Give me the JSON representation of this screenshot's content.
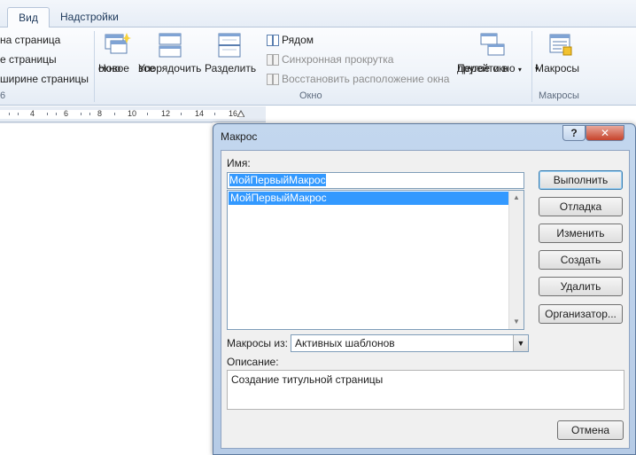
{
  "tabs": {
    "view": "Вид",
    "addins": "Надстройки"
  },
  "ribbon": {
    "page_view_items": [
      "на страница",
      "е страницы",
      "ширине страницы"
    ],
    "zoom_group_label_fragment": "6",
    "window_group": {
      "new_window": [
        "Новое",
        "окно"
      ],
      "arrange_all": [
        "Упорядочить",
        "все"
      ],
      "split": "Разделить",
      "side_by_side": "Рядом",
      "sync_scroll": "Синхронная прокрутка",
      "reset_position": "Восстановить расположение окна",
      "group_label": "Окно",
      "switch_windows": [
        "Перейти в",
        "другое окно"
      ]
    },
    "macros_group": {
      "macros_button": "Макросы",
      "group_label": "Макросы"
    }
  },
  "ruler": {
    "numbers": [
      "4",
      "6",
      "8",
      "10",
      "12",
      "14",
      "16"
    ]
  },
  "dialog": {
    "title": "Макрос",
    "help": "?",
    "close": "✕",
    "name_label": "Имя:",
    "name_value": "МойПервыйМакрос",
    "macros": [
      "МойПервыйМакрос"
    ],
    "buttons": {
      "run": "Выполнить",
      "debug": "Отладка",
      "edit": "Изменить",
      "create": "Создать",
      "delete": "Удалить",
      "organizer": "Организатор..."
    },
    "macros_in_label": "Макросы из:",
    "macros_in_value": "Активных шаблонов",
    "description_label": "Описание:",
    "description": "Создание титульной страницы",
    "cancel": "Отмена"
  },
  "colors": {
    "selection": "#3399ff",
    "dialog_frame": "#b6cbe6",
    "ribbon_bg": "#eef3f9"
  }
}
